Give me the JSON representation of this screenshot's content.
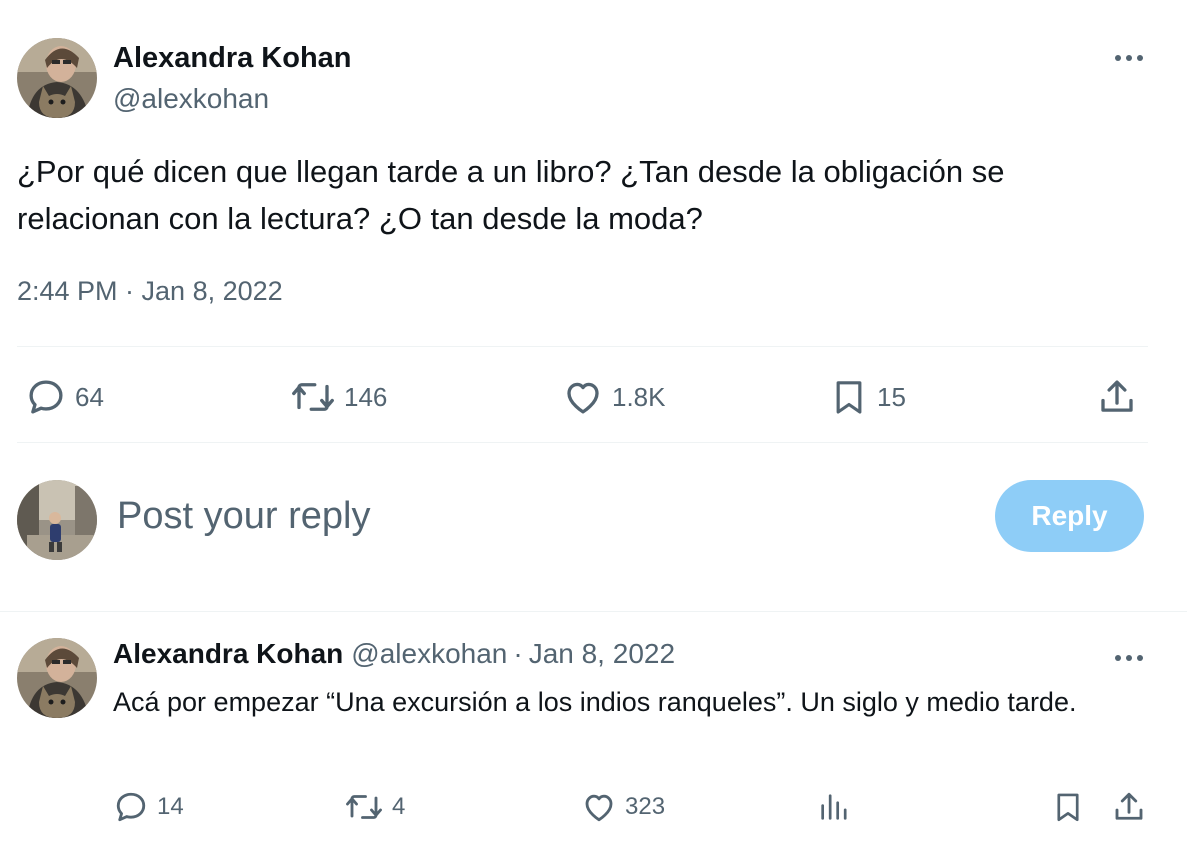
{
  "main_tweet": {
    "author_name": "Alexandra Kohan",
    "author_handle": "@alexkohan",
    "text": "¿Por qué dicen que llegan tarde a un libro? ¿Tan desde la obligación se relacionan con la lectura? ¿O tan desde la moda?",
    "timestamp": "2:44 PM · Jan 8, 2022",
    "stats": {
      "replies": "64",
      "retweets": "146",
      "likes": "1.8K",
      "bookmarks": "15"
    }
  },
  "composer": {
    "placeholder": "Post your reply",
    "reply_button": "Reply"
  },
  "reply_tweet": {
    "author_name": "Alexandra Kohan",
    "author_handle": "@alexkohan",
    "separator": "·",
    "date": "Jan 8, 2022",
    "text": "Acá por empezar “Una excursión a los indios ranqueles”. Un siglo y medio tarde.",
    "stats": {
      "replies": "14",
      "retweets": "4",
      "likes": "323"
    }
  },
  "colors": {
    "text_primary": "#0f1419",
    "text_secondary": "#536471",
    "divider": "#eff3f4",
    "reply_button_bg": "#8ecdf7"
  },
  "icons": [
    "more-icon",
    "reply-icon",
    "retweet-icon",
    "like-icon",
    "bookmark-icon",
    "share-icon",
    "views-icon"
  ]
}
